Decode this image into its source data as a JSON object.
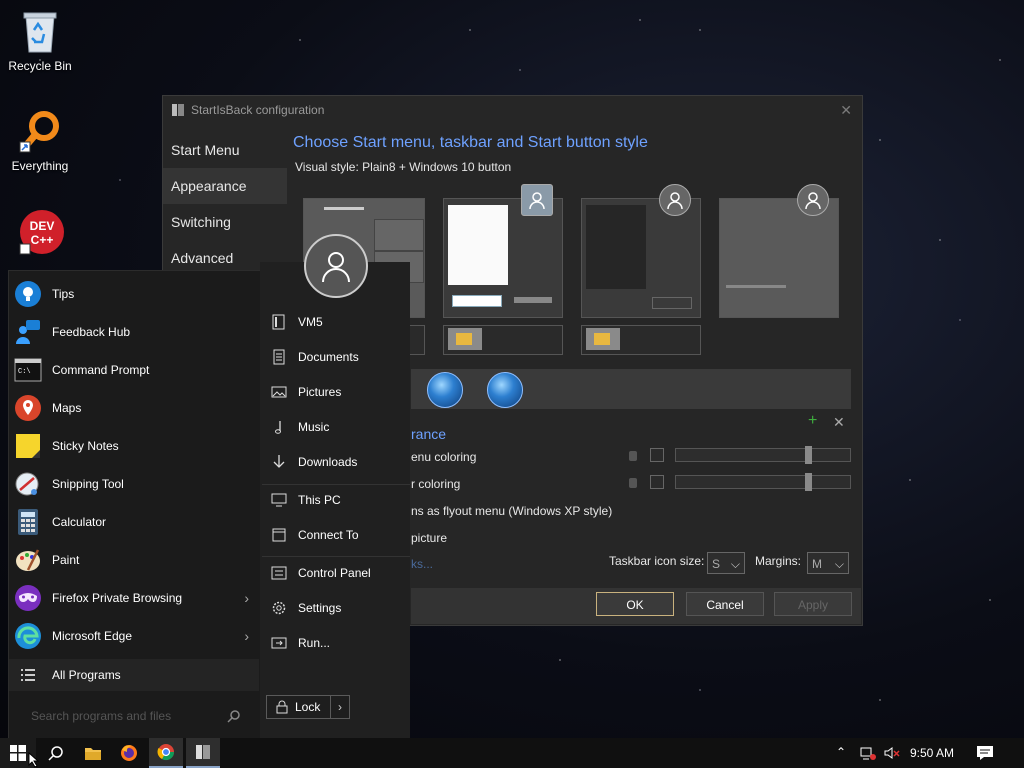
{
  "desktop": {
    "icons": [
      {
        "label": "Recycle Bin"
      },
      {
        "label": "Everything"
      },
      {
        "label": ""
      }
    ]
  },
  "config": {
    "title": "StartIsBack configuration",
    "nav": [
      "Start Menu",
      "Appearance",
      "Switching",
      "Advanced"
    ],
    "active_nav": "Appearance",
    "heading": "Choose Start menu, taskbar and Start button style",
    "visual_style": "Visual style:  Plain8 + Windows 10 button",
    "section": "rance",
    "options": [
      "enu coloring",
      "r coloring",
      "ns as flyout menu (Windows XP style)",
      "picture",
      "ks..."
    ],
    "taskbar_icon_size_label": "Taskbar icon size:",
    "taskbar_icon_size_value": "S",
    "margins_label": "Margins:",
    "margins_value": "M",
    "ok": "OK",
    "cancel": "Cancel",
    "apply": "Apply",
    "accent_color": "#6ea1ff"
  },
  "start_menu": {
    "apps": [
      {
        "label": "Tips",
        "icon": "tips-icon"
      },
      {
        "label": "Feedback Hub",
        "icon": "feedback-hub-icon"
      },
      {
        "label": "Command Prompt",
        "icon": "command-prompt-icon"
      },
      {
        "label": "Maps",
        "icon": "maps-icon"
      },
      {
        "label": "Sticky Notes",
        "icon": "sticky-notes-icon"
      },
      {
        "label": "Snipping Tool",
        "icon": "snipping-tool-icon"
      },
      {
        "label": "Calculator",
        "icon": "calculator-icon"
      },
      {
        "label": "Paint",
        "icon": "paint-icon"
      },
      {
        "label": "Firefox Private Browsing",
        "icon": "firefox-private-icon",
        "submenu": true
      },
      {
        "label": "Microsoft Edge",
        "icon": "edge-icon",
        "submenu": true
      }
    ],
    "all_programs": "All Programs",
    "search_placeholder": "Search programs and files",
    "right_items": [
      {
        "label": "VM5",
        "icon": "user-folder-icon"
      },
      {
        "label": "Documents",
        "icon": "documents-icon"
      },
      {
        "label": "Pictures",
        "icon": "pictures-icon"
      },
      {
        "label": "Music",
        "icon": "music-icon"
      },
      {
        "label": "Downloads",
        "icon": "downloads-icon"
      },
      {
        "label": "This PC",
        "icon": "this-pc-icon"
      },
      {
        "label": "Connect To",
        "icon": "connect-to-icon"
      },
      {
        "label": "Control Panel",
        "icon": "control-panel-icon"
      },
      {
        "label": "Settings",
        "icon": "settings-gear-icon"
      },
      {
        "label": "Run...",
        "icon": "run-icon"
      }
    ],
    "lock": "Lock"
  },
  "taskbar": {
    "time": "9:50 AM",
    "buttons": [
      "start",
      "search",
      "file-explorer",
      "firefox",
      "chrome",
      "startisback-config"
    ]
  }
}
